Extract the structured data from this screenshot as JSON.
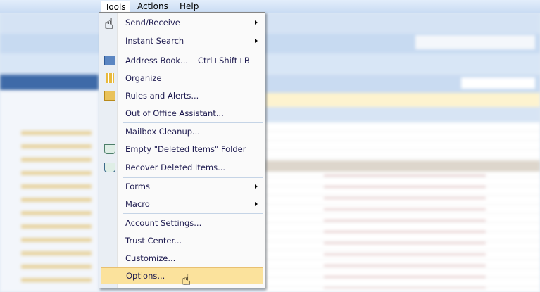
{
  "menubar": {
    "items": [
      {
        "label": "Tools",
        "active": true
      },
      {
        "label": "Actions"
      },
      {
        "label": "Help"
      }
    ]
  },
  "tools_menu": {
    "items": [
      {
        "label": "Send/Receive",
        "submenu": true
      },
      {
        "label": "Instant Search",
        "submenu": true
      },
      {
        "label": "Address Book...",
        "shortcut": "Ctrl+Shift+B",
        "icon": "address-book-icon"
      },
      {
        "label": "Organize",
        "icon": "organize-icon"
      },
      {
        "label": "Rules and Alerts...",
        "icon": "rules-icon"
      },
      {
        "label": "Out of Office Assistant..."
      },
      {
        "label": "Mailbox Cleanup..."
      },
      {
        "label": "Empty \"Deleted Items\" Folder",
        "icon": "empty-trash-icon"
      },
      {
        "label": "Recover Deleted Items...",
        "icon": "recover-icon"
      },
      {
        "label": "Forms",
        "submenu": true
      },
      {
        "label": "Macro",
        "submenu": true
      },
      {
        "label": "Account Settings..."
      },
      {
        "label": "Trust Center..."
      },
      {
        "label": "Customize..."
      },
      {
        "label": "Options...",
        "highlighted": true
      }
    ]
  },
  "colors": {
    "highlight": "#fbe29c",
    "menu_text": "#1e1b50"
  }
}
